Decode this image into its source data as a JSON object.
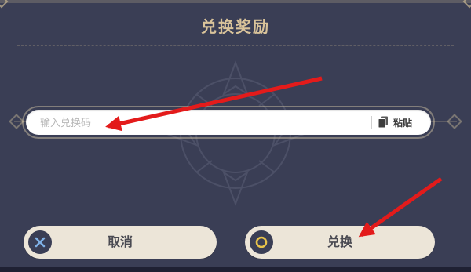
{
  "dialog": {
    "title": "兑换奖励",
    "input": {
      "placeholder": "输入兑换码",
      "value": ""
    },
    "paste": {
      "label": "粘贴",
      "icon": "paste-icon"
    },
    "buttons": {
      "cancel": {
        "label": "取消",
        "icon": "close-x-icon",
        "icon_color": "#7fb0e6"
      },
      "confirm": {
        "label": "兑换",
        "icon": "ring-icon",
        "icon_color": "#e8c34a"
      }
    }
  },
  "colors": {
    "panel": "#3a3e55",
    "title": "#d9c39a",
    "button": "#ece5d8",
    "annotation_arrow": "#e31b1b"
  }
}
